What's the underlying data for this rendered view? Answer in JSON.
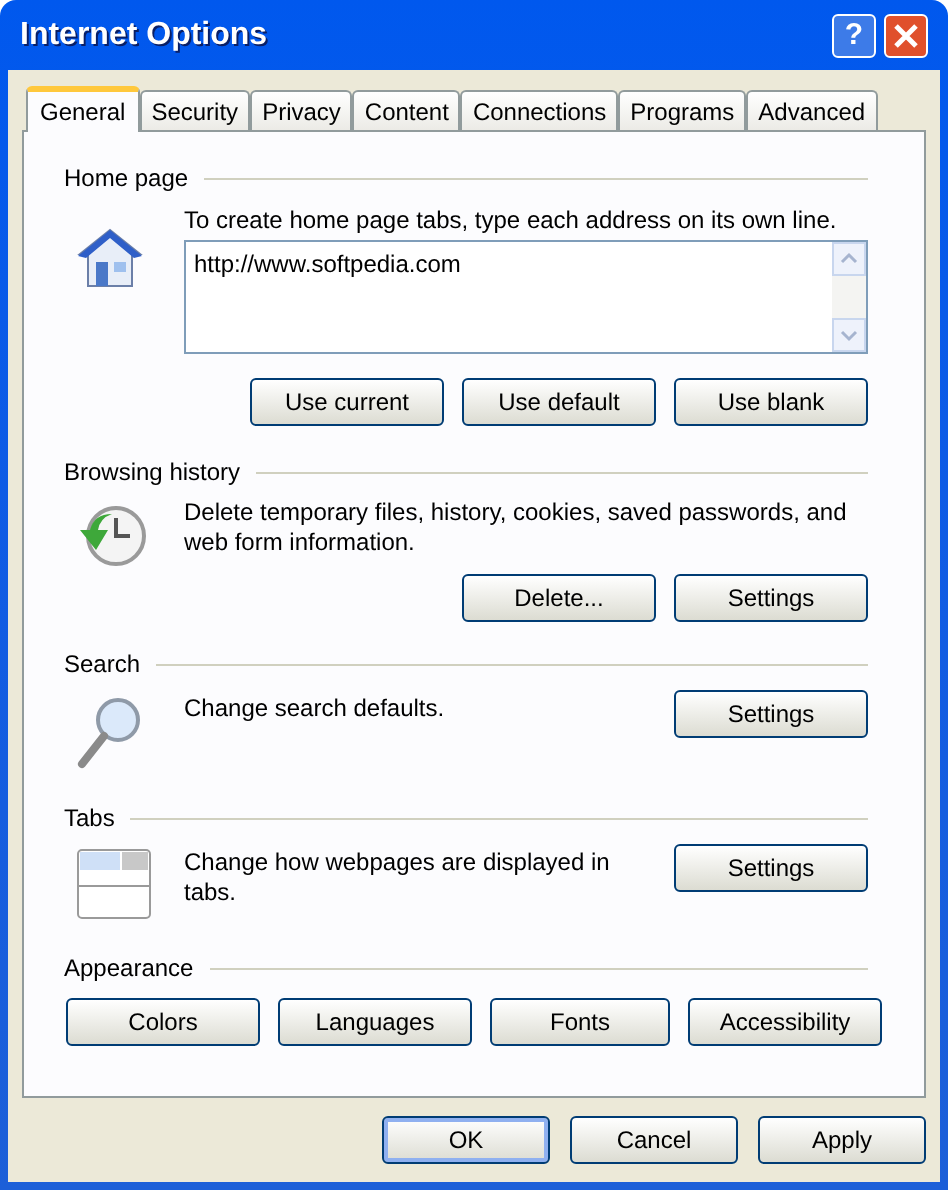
{
  "window": {
    "title": "Internet Options",
    "help_button": "?"
  },
  "tabs": [
    {
      "label": "General",
      "selected": true
    },
    {
      "label": "Security",
      "selected": false
    },
    {
      "label": "Privacy",
      "selected": false
    },
    {
      "label": "Content",
      "selected": false
    },
    {
      "label": "Connections",
      "selected": false
    },
    {
      "label": "Programs",
      "selected": false
    },
    {
      "label": "Advanced",
      "selected": false
    }
  ],
  "sections": [
    {
      "kind": "home",
      "heading": "Home page",
      "description": "To create home page tabs, type each address on its own line.",
      "address_field": {
        "value": "http://www.softpedia.com"
      },
      "buttons": [
        "Use current",
        "Use default",
        "Use blank"
      ]
    },
    {
      "kind": "history",
      "heading": "Browsing history",
      "description": "Delete temporary files, history, cookies, saved passwords, and web form information.",
      "buttons": [
        "Delete...",
        "Settings"
      ]
    },
    {
      "kind": "search",
      "heading": "Search",
      "description": "Change search defaults.",
      "buttons": [
        "Settings"
      ]
    },
    {
      "kind": "tabs",
      "heading": "Tabs",
      "description": "Change how webpages are displayed in tabs.",
      "buttons": [
        "Settings"
      ]
    },
    {
      "kind": "appearance",
      "heading": "Appearance",
      "buttons": [
        "Colors",
        "Languages",
        "Fonts",
        "Accessibility"
      ]
    }
  ],
  "footer_buttons": [
    {
      "label": "OK",
      "default": true
    },
    {
      "label": "Cancel",
      "default": false
    },
    {
      "label": "Apply",
      "default": false
    }
  ]
}
